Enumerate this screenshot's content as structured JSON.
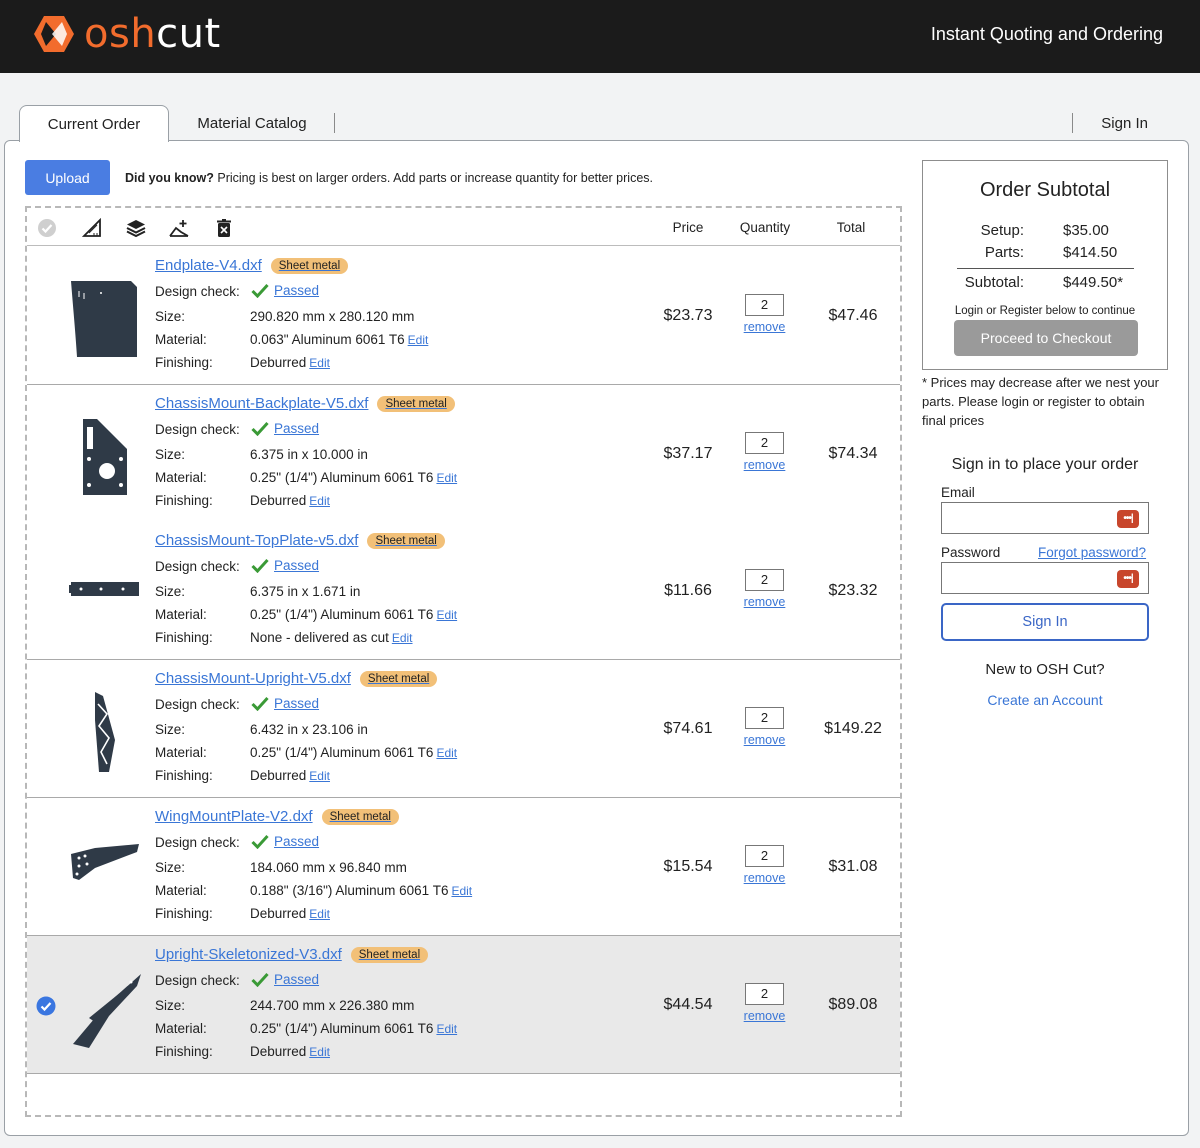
{
  "header": {
    "logo_osh": "osh",
    "logo_cut": "cut",
    "tagline": "Instant Quoting and Ordering"
  },
  "tabs": {
    "current_order": "Current Order",
    "material_catalog": "Material Catalog",
    "sign_in": "Sign In"
  },
  "upload": {
    "label": "Upload",
    "tip_bold": "Did you know?",
    "tip_text": " Pricing is best on larger orders. Add parts or increase quantity for better prices."
  },
  "columns": {
    "price": "Price",
    "quantity": "Quantity",
    "total": "Total"
  },
  "labels": {
    "design_check": "Design check:",
    "size": "Size:",
    "material": "Material:",
    "finishing": "Finishing:",
    "passed": "Passed",
    "edit": "Edit",
    "remove": "remove",
    "badge": "Sheet metal"
  },
  "parts": [
    {
      "name": "Endplate-V4.dxf",
      "size": "290.820 mm x 280.120 mm",
      "material": "0.063\" Aluminum 6061 T6",
      "finishing": "Deburred",
      "price": "$23.73",
      "qty": "2",
      "total": "$47.46"
    },
    {
      "name": "ChassisMount-Backplate-V5.dxf",
      "size": "6.375 in x 10.000 in",
      "material": "0.25\" (1/4\") Aluminum 6061 T6",
      "finishing": "Deburred",
      "price": "$37.17",
      "qty": "2",
      "total": "$74.34"
    },
    {
      "name": "ChassisMount-TopPlate-v5.dxf",
      "size": "6.375 in x 1.671 in",
      "material": "0.25\" (1/4\") Aluminum 6061 T6",
      "finishing": "None - delivered as cut",
      "price": "$11.66",
      "qty": "2",
      "total": "$23.32"
    },
    {
      "name": "ChassisMount-Upright-V5.dxf",
      "size": "6.432 in x 23.106 in",
      "material": "0.25\" (1/4\") Aluminum 6061 T6",
      "finishing": "Deburred",
      "price": "$74.61",
      "qty": "2",
      "total": "$149.22"
    },
    {
      "name": "WingMountPlate-V2.dxf",
      "size": "184.060 mm x 96.840 mm",
      "material": "0.188\" (3/16\") Aluminum 6061 T6",
      "finishing": "Deburred",
      "price": "$15.54",
      "qty": "2",
      "total": "$31.08"
    },
    {
      "name": "Upright-Skeletonized-V3.dxf",
      "size": "244.700 mm x 226.380 mm",
      "material": "0.25\" (1/4\") Aluminum 6061 T6",
      "finishing": "Deburred",
      "price": "$44.54",
      "qty": "2",
      "total": "$89.08"
    }
  ],
  "subtotal": {
    "title": "Order Subtotal",
    "setup_label": "Setup:",
    "setup_value": "$35.00",
    "parts_label": "Parts:",
    "parts_value": "$414.50",
    "subtotal_label": "Subtotal:",
    "subtotal_value": "$449.50*",
    "login_note": "Login or Register below to continue",
    "checkout": "Proceed to Checkout",
    "prices_note": "* Prices may decrease after we nest your parts.  Please login or register to obtain final prices"
  },
  "signin": {
    "title": "Sign in to place your order",
    "email_label": "Email",
    "password_label": "Password",
    "forgot": "Forgot password?",
    "button": "Sign In",
    "new_title": "New to OSH Cut?",
    "create": "Create an Account",
    "pw_manager_glyph": "•••|"
  },
  "colors": {
    "brand_orange": "#f26c2d",
    "link_blue": "#3a76d6",
    "upload_blue": "#4a7de2",
    "badge": "#f2c078",
    "passed_green": "#3a9a36"
  }
}
